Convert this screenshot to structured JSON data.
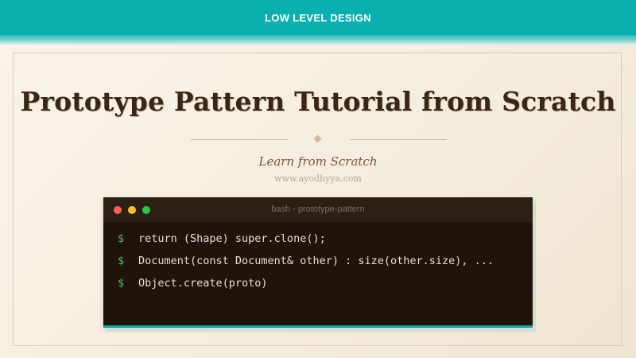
{
  "header": {
    "category_label": "LOW LEVEL DESIGN"
  },
  "main": {
    "title": "Prototype Pattern Tutorial from Scratch",
    "subtitle": "Learn from Scratch",
    "site_url": "www.ayodhyya.com"
  },
  "terminal": {
    "window_title": "bash - prototype-pattern",
    "prompt_symbol": "$",
    "lines": [
      "return (Shape) super.clone();",
      "Document(const Document& other) : size(other.size), ...",
      "Object.create(proto)"
    ]
  },
  "colors": {
    "banner": "#0ab0b0",
    "background": "#f6efe2",
    "title": "#3a2616",
    "subtitle": "#7a5536",
    "terminal_bg": "#1f140c",
    "terminal_text": "#e9ddc6",
    "prompt": "#58b86b",
    "accent_bottom": "#12a5a5"
  },
  "icons": {
    "close": "close-dot-icon",
    "minimize": "minimize-dot-icon",
    "maximize": "maximize-dot-icon",
    "divider": "diamond-ornament-icon"
  }
}
